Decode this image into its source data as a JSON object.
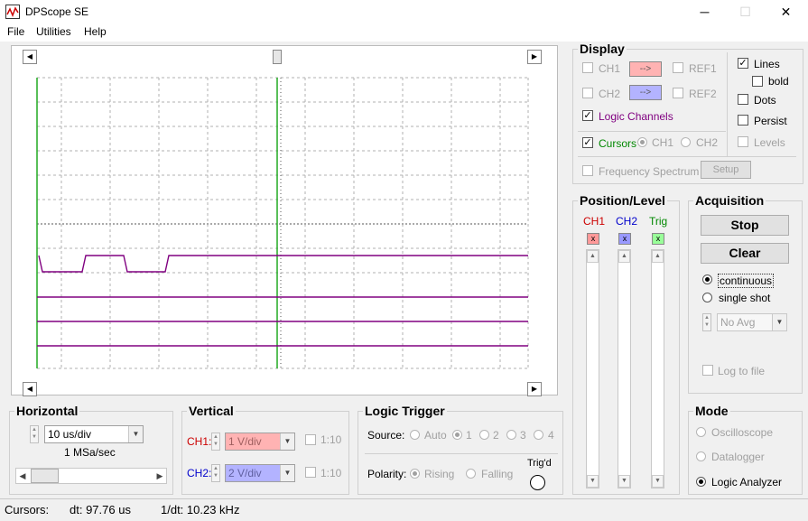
{
  "window": {
    "title": "DPScope SE",
    "minimize": "─",
    "maximize": "☐",
    "close": "✕"
  },
  "menu": {
    "file": "File",
    "utilities": "Utilities",
    "help": "Help"
  },
  "display": {
    "title": "Display",
    "ch1": "CH1",
    "ch2": "CH2",
    "ref_btn": "-->",
    "ref1": "REF1",
    "ref2": "REF2",
    "logic": "Logic Channels",
    "cursors": "Cursors",
    "cursor_ch1": "CH1",
    "cursor_ch2": "CH2",
    "spectrum": "Frequency Spectrum",
    "setup": "Setup",
    "lines": "Lines",
    "bold": "bold",
    "dots": "Dots",
    "persist": "Persist",
    "levels": "Levels",
    "colors": {
      "ch1": "#cc0000",
      "ch2": "#0000cc",
      "trig": "#008800",
      "logic": "#800080"
    }
  },
  "position": {
    "title": "Position/Level",
    "ch1": "CH1",
    "ch2": "CH2",
    "trig": "Trig",
    "mark": "x"
  },
  "acquisition": {
    "title": "Acquisition",
    "stop": "Stop",
    "clear": "Clear",
    "continuous": "continuous",
    "single": "single shot",
    "avg": "No Avg",
    "log": "Log to file"
  },
  "mode": {
    "title": "Mode",
    "osc": "Oscilloscope",
    "datalogger": "Datalogger",
    "logic": "Logic Analyzer"
  },
  "horizontal": {
    "title": "Horizontal",
    "timebase": "10 us/div",
    "rate": "1 MSa/sec"
  },
  "vertical": {
    "title": "Vertical",
    "ch1": "CH1:",
    "ch1_value": "1 V/div",
    "ch2": "CH2:",
    "ch2_value": "2 V/div",
    "ratio": "1:10"
  },
  "trigger": {
    "title": "Logic Trigger",
    "source": "Source:",
    "auto": "Auto",
    "s1": "1",
    "s2": "2",
    "s3": "3",
    "s4": "4",
    "polarity": "Polarity:",
    "rising": "Rising",
    "falling": "Falling",
    "trigd": "Trig'd"
  },
  "status": {
    "cursors": "Cursors:",
    "dt": "dt: 97.76 us",
    "inv_dt": "1/dt: 10.23 kHz"
  },
  "arrows": {
    "left": "◀",
    "right": "▶",
    "up": "▲",
    "down": "▼"
  }
}
